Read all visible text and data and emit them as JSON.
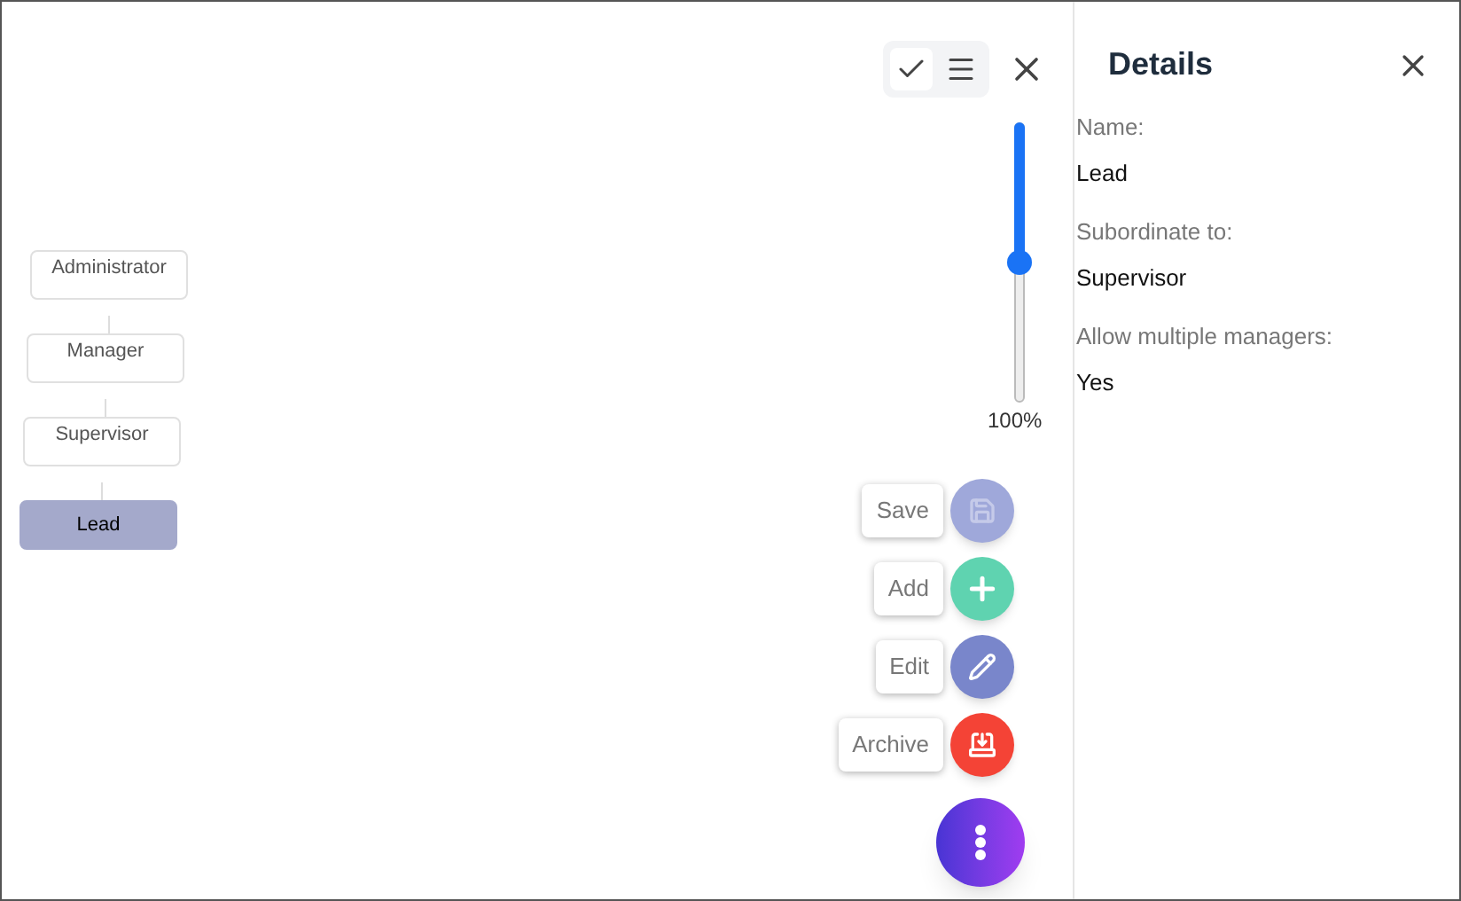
{
  "diagram": {
    "nodes": [
      {
        "label": "Administrator",
        "selected": false
      },
      {
        "label": "Manager",
        "selected": false
      },
      {
        "label": "Supervisor",
        "selected": false
      },
      {
        "label": "Lead",
        "selected": true
      }
    ]
  },
  "toolbar": {
    "view_toggle": [
      {
        "kind": "check",
        "selected": true
      },
      {
        "kind": "list",
        "selected": false
      }
    ]
  },
  "zoom": {
    "level": 0.5,
    "reading": "100%"
  },
  "actions": [
    {
      "kind": "save",
      "label": "Save",
      "color": "#9fa8da",
      "disabled": true
    },
    {
      "kind": "add",
      "label": "Add",
      "color": "#5fd3b0",
      "disabled": false
    },
    {
      "kind": "edit",
      "label": "Edit",
      "color": "#7986cb",
      "disabled": false
    },
    {
      "kind": "archive",
      "label": "Archive",
      "color": "#f44336",
      "disabled": false
    }
  ],
  "details": {
    "title": "Details",
    "fields": [
      {
        "label": "Name:",
        "value": "Lead"
      },
      {
        "label": "Subordinate to:",
        "value": "Supervisor"
      },
      {
        "label": "Allow multiple managers:",
        "value": "Yes"
      }
    ]
  }
}
